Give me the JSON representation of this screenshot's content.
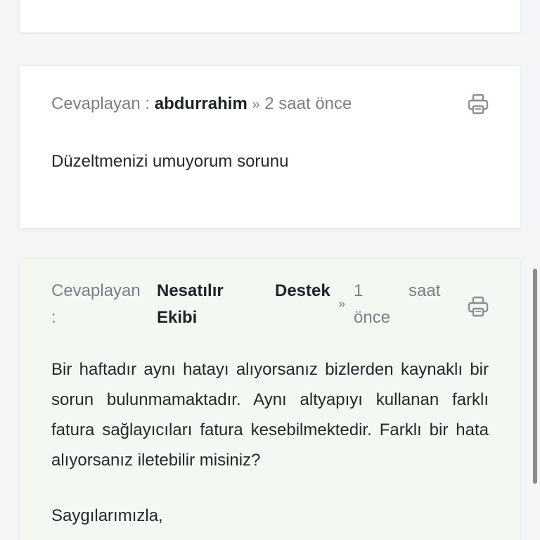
{
  "replies": [
    {
      "prefix": "Cevaplayan :",
      "author": "abdurrahim",
      "separator": "»",
      "time": "2 saat önce",
      "body": "Düzeltmenizi umuyorum sorunu",
      "print_icon": "printer-icon"
    },
    {
      "prefix_word": "Cevaplayan",
      "prefix_colon": ":",
      "author_line1_a": "Nesatılır",
      "author_line1_b": "Destek",
      "author_line2": "Ekibi",
      "separator": "»",
      "time_num": "1",
      "time_unit": "saat",
      "time_suffix": "önce",
      "body": "Bir haftadır aynı hatayı alıyorsanız bizlerden kaynaklı bir sorun bulunmamaktadır. Aynı altyapıyı kullanan farklı fatura sağlayıcıları fatura kesebilmektedir. Farklı bir hata alıyorsanız iletebilir misiniz?",
      "closing": "Saygılarımızla,",
      "print_icon": "printer-icon"
    }
  ]
}
